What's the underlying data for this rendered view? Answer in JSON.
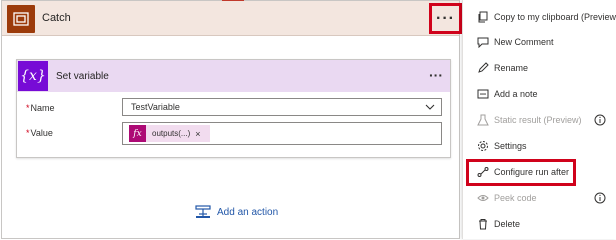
{
  "scope": {
    "title": "Catch",
    "more_label": "···"
  },
  "action": {
    "icon_text": "{x}",
    "title": "Set variable",
    "more_label": "···",
    "name_label": "Name",
    "name_value": "TestVariable",
    "value_label": "Value",
    "token_icon_text": "fx",
    "token_text": "outputs(...)",
    "token_remove": "×",
    "required_marker": "*"
  },
  "add_action": {
    "label": "Add an action"
  },
  "menu": {
    "items": [
      {
        "label": "Copy to my clipboard (Preview)",
        "icon": "copy-icon",
        "disabled": false,
        "info": false
      },
      {
        "label": "New Comment",
        "icon": "comment-icon",
        "disabled": false,
        "info": false
      },
      {
        "label": "Rename",
        "icon": "pencil-icon",
        "disabled": false,
        "info": false
      },
      {
        "label": "Add a note",
        "icon": "note-icon",
        "disabled": false,
        "info": false
      },
      {
        "label": "Static result (Preview)",
        "icon": "flask-icon",
        "disabled": true,
        "info": true
      },
      {
        "label": "Settings",
        "icon": "gear-icon",
        "disabled": false,
        "info": false
      },
      {
        "label": "Configure run after",
        "icon": "run-after-icon",
        "disabled": false,
        "info": false
      },
      {
        "label": "Peek code",
        "icon": "eye-icon",
        "disabled": true,
        "info": true
      },
      {
        "label": "Delete",
        "icon": "trash-icon",
        "disabled": false,
        "info": false
      }
    ]
  },
  "colors": {
    "scope_accent": "#9c3b0b",
    "variable_accent": "#770bd6",
    "expression_accent": "#ad0a75",
    "highlight": "#d0021b",
    "link": "#2257a8"
  }
}
